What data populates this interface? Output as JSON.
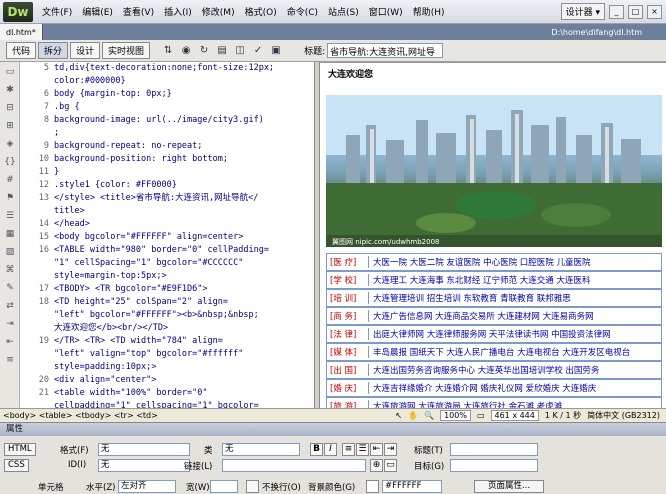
{
  "app": {
    "logo": "Dw"
  },
  "menu": [
    "文件(F)",
    "编辑(E)",
    "查看(V)",
    "插入(I)",
    "修改(M)",
    "格式(O)",
    "命令(C)",
    "站点(S)",
    "窗口(W)",
    "帮助(H)"
  ],
  "workspace": {
    "label": "设计器 ▾"
  },
  "window_buttons": [
    "_",
    "□",
    "×"
  ],
  "doc": {
    "tab": "dl.htm*",
    "path": "D:\\home\\difang\\dl.htm"
  },
  "toolbar": {
    "views": [
      "代码",
      "拆分",
      "设计",
      "实时视图"
    ],
    "title_label": "标题:",
    "title_value": "省市导航:大连资讯,网址导"
  },
  "code_lines": [
    {
      "n": "5",
      "t": "td,div{text-decoration:none;font-size:12px;"
    },
    {
      "n": "",
      "t": "color:#000000}"
    },
    {
      "n": "6",
      "t": "body {margin-top: 0px;}"
    },
    {
      "n": "7",
      "t": ".bg {"
    },
    {
      "n": "8",
      "t": "    background-image: url(../image/city3.gif)"
    },
    {
      "n": "",
      "t": ";"
    },
    {
      "n": "9",
      "t": "    background-repeat: no-repeat;"
    },
    {
      "n": "10",
      "t": "    background-position: right bottom;"
    },
    {
      "n": "11",
      "t": "}"
    },
    {
      "n": "12",
      "t": ".style1 {color: #FF0000}"
    },
    {
      "n": "13",
      "t": "</style>  <title>省市导航:大连资讯,网址导航</"
    },
    {
      "n": "",
      "t": "title>"
    },
    {
      "n": "14",
      "t": "</head>"
    },
    {
      "n": "15",
      "t": "<body bgcolor=\"#FFFFFF\" align=center>"
    },
    {
      "n": "16",
      "t": "<TABLE  width=\"980\" border=\"0\"  cellPadding="
    },
    {
      "n": "",
      "t": "\"1\" cellSpacing=\"1\" bgcolor=\"#CCCCCC\""
    },
    {
      "n": "",
      "t": "style=margin-top:5px;>"
    },
    {
      "n": "17",
      "t": "  <TBODY>   <TR bgcolor=\"#E9F1D6\">"
    },
    {
      "n": "18",
      "t": "      <TD  height=\"25\" colSpan=\"2\"  align="
    },
    {
      "n": "",
      "t": "\"left\" bgcolor=\"#FFFFFF\"><b>&nbsp;&nbsp;"
    },
    {
      "n": "",
      "t": "大连欢迎您</b><br/></TD>"
    },
    {
      "n": "19",
      "t": "     </TR>   <TR>   <TD width=\"784\"  align="
    },
    {
      "n": "",
      "t": "\"left\" valign=\"top\"  bgcolor=\"#ffffff\""
    },
    {
      "n": "",
      "t": "style=padding:10px;>"
    },
    {
      "n": "20",
      "t": "       <div align=\"center\">"
    },
    {
      "n": "21",
      "t": "         <table width=\"100%\" border=\"0\""
    },
    {
      "n": "",
      "t": "cellpadding=\"1\" cellspacing=\"1\" bgcolor="
    },
    {
      "n": "",
      "t": "\"#CCCCCC\" class=\"hangye\">"
    },
    {
      "n": "22",
      "t": "            <tr bgcolor=\"#FFFFFF\" >"
    },
    {
      "n": "23",
      "t": "              <td height=\"22\" class=\"hyl\"><a"
    }
  ],
  "design": {
    "welcome": "大连欢迎您",
    "image_caption": "翼图网 nipic.com/udwhmb2008",
    "rows": [
      {
        "cat": "[医 疗]",
        "links": "大医一院   大医二院   友谊医院   中心医院   口腔医院   儿童医院"
      },
      {
        "cat": "[学 校]",
        "links": "大连理工   大连海事   东北财经   辽宁师范   大连交通   大连医科"
      },
      {
        "cat": "[培 训]",
        "links": "大连管理培训   招生培训   东软教育   青联教育   联邦雅思"
      },
      {
        "cat": "[商 务]",
        "links": "大连广告信息网   大连商品交易所   大连建材网   大连易商务网"
      },
      {
        "cat": "[法 律]",
        "links": "出庭大律师网   大连律师服务网   天平法律读书网   中国投资法律网"
      },
      {
        "cat": "[媒 体]",
        "links": "丰岛晨报   国纸天下   大连人民广播电台   大连电视台   大连开发区电视台"
      },
      {
        "cat": "[出 国]",
        "links": "大连出国劳务咨询服务中心   大连英华出国培训学校   出国劳务"
      },
      {
        "cat": "[婚 庆]",
        "links": "大连吉祥缘婚介   大连婚介网   婚庆礼仪网   爱欣婚庆   大连婚庆"
      },
      {
        "cat": "[旅 游]",
        "links": "大连旅游网   大连旅游局   大连旅行社   金石滩   老虎滩"
      }
    ]
  },
  "status": {
    "tagpath": "<body> <table> <tbody> <tr> <td>",
    "zoom": "100%",
    "size": "461 x 444",
    "download": "1 K / 1 秒",
    "encoding": "简体中文 (GB2312)"
  },
  "props": {
    "header": "属性",
    "html_btn": "HTML",
    "css_btn": "CSS",
    "format_label": "格式(F)",
    "format_value": "无",
    "class_label": "类",
    "class_value": "无",
    "title_label": "标题(T)",
    "id_label": "ID(I)",
    "id_value": "无",
    "link_label": "链接(L)",
    "target_label": "目标(G)",
    "cell_label": "单元格",
    "horz_label": "水平(Z)",
    "horz_value": "左对齐",
    "width_label": "宽(W)",
    "nowrap_label": "不换行(O)",
    "bg_label": "背景颜色(G)",
    "bg_value": "#FFFFFF",
    "page_props_btn": "页面属性..."
  }
}
